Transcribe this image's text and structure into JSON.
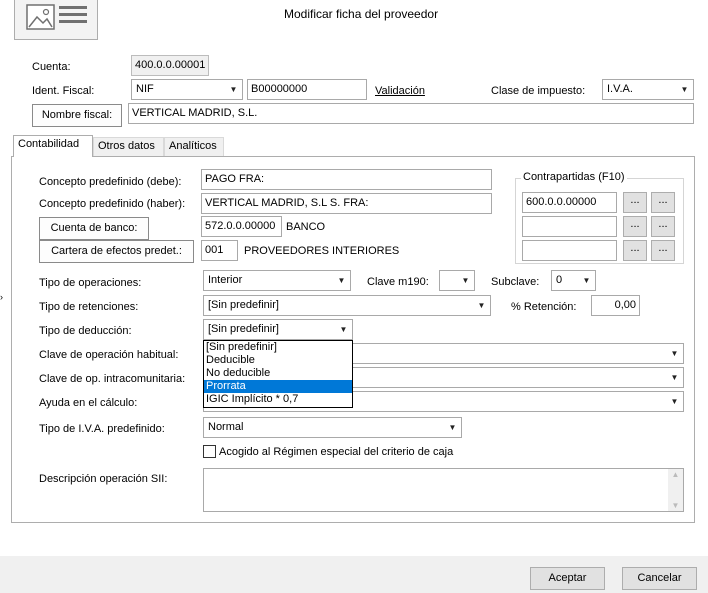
{
  "window": {
    "title": "Modificar ficha del proveedor"
  },
  "header": {
    "cuenta_label": "Cuenta:",
    "cuenta_value": "400.0.0.00001",
    "ident_label": "Ident. Fiscal:",
    "ident_type": "NIF",
    "ident_value": "B00000000",
    "validacion_link": "Validación",
    "clase_label": "Clase de impuesto:",
    "clase_value": "I.V.A.",
    "nombre_button": "Nombre fiscal:",
    "nombre_value": "VERTICAL MADRID, S.L."
  },
  "tabs": [
    {
      "label": "Contabilidad"
    },
    {
      "label": "Otros datos"
    },
    {
      "label": "Analíticos"
    }
  ],
  "form": {
    "concepto_debe_label": "Concepto predefinido (debe):",
    "concepto_debe_value": "PAGO FRA:",
    "concepto_haber_label": "Concepto predefinido (haber):",
    "concepto_haber_value": "VERTICAL MADRID, S.L S. FRA:",
    "cuenta_banco_button": "Cuenta de banco:",
    "cuenta_banco_value": "572.0.0.00000",
    "cuenta_banco_name": "BANCO",
    "cartera_button": "Cartera de efectos predet.:",
    "cartera_value": "001",
    "cartera_name": "PROVEEDORES INTERIORES",
    "contrapartidas_title": "Contrapartidas (F10)",
    "contrapartidas_values": [
      "600.0.0.00000",
      "",
      ""
    ],
    "ellipsis": "...",
    "tipo_operaciones_label": "Tipo de operaciones:",
    "tipo_operaciones_value": "Interior",
    "clave_m190_label": "Clave m190:",
    "clave_m190_value": "",
    "subclave_label": "Subclave:",
    "subclave_value": "0",
    "tipo_retenciones_label": "Tipo de retenciones:",
    "tipo_retenciones_value": "[Sin predefinir]",
    "retencion_label": "% Retención:",
    "retencion_value": "0,00",
    "tipo_deduccion_label": "Tipo de deducción:",
    "tipo_deduccion_value": "[Sin predefinir]",
    "tipo_deduccion_options": [
      "[Sin predefinir]",
      "Deducible",
      "No deducible",
      "Prorrata",
      "IGIC Implícito * 0,7"
    ],
    "tipo_deduccion_highlighted": "Prorrata",
    "clave_habitual_label": "Clave de operación habitual:",
    "clave_intra_label": "Clave de op. intracomunitaria:",
    "ayuda_label": "Ayuda en el cálculo:",
    "tipo_iva_label": "Tipo de I.V.A. predefinido:",
    "tipo_iva_value": "Normal",
    "criterio_caja_label": "Acogido al Régimen especial del criterio de caja",
    "criterio_caja_checked": false,
    "descripcion_label": "Descripción operación SII:",
    "descripcion_value": ""
  },
  "footer": {
    "aceptar": "Aceptar",
    "cancelar": "Cancelar"
  }
}
